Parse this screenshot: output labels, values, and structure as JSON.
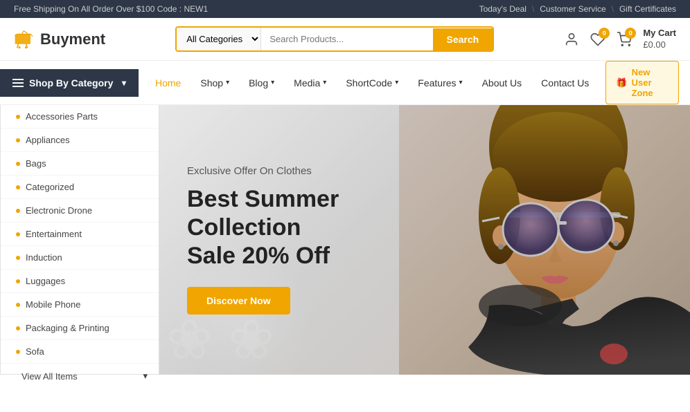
{
  "topbar": {
    "shipping_text": "Free Shipping On All Order Over $100 Code : NEW1",
    "todays_deal": "Today's Deal",
    "customer_service": "Customer Service",
    "gift_certificates": "Gift Certificates"
  },
  "header": {
    "logo_text": "Buyment",
    "search": {
      "placeholder": "Search Products...",
      "category_default": "All Categories",
      "button_label": "Search"
    },
    "cart": {
      "label": "My Cart",
      "price": "£0.00",
      "count": "0"
    },
    "wishlist_count": "0"
  },
  "navbar": {
    "shop_by_category": "Shop By Category",
    "links": [
      {
        "label": "Home",
        "active": true,
        "has_dropdown": false
      },
      {
        "label": "Shop",
        "active": false,
        "has_dropdown": true
      },
      {
        "label": "Blog",
        "active": false,
        "has_dropdown": true
      },
      {
        "label": "Media",
        "active": false,
        "has_dropdown": true
      },
      {
        "label": "ShortCode",
        "active": false,
        "has_dropdown": true
      },
      {
        "label": "Features",
        "active": false,
        "has_dropdown": true
      },
      {
        "label": "About Us",
        "active": false,
        "has_dropdown": false
      },
      {
        "label": "Contact Us",
        "active": false,
        "has_dropdown": false
      }
    ],
    "new_user_zone": "New User Zone"
  },
  "categories": [
    "Accessories Parts",
    "Appliances",
    "Bags",
    "Categorized",
    "Electronic Drone",
    "Entertainment",
    "Induction",
    "Luggages",
    "Mobile Phone",
    "Packaging & Printing",
    "Sofa"
  ],
  "view_all": "View All Items",
  "hero": {
    "subtitle": "Exclusive Offer On Clothes",
    "title_line1": "Best Summer Collection",
    "title_line2": "Sale 20% Off",
    "button_label": "Discover Now"
  }
}
